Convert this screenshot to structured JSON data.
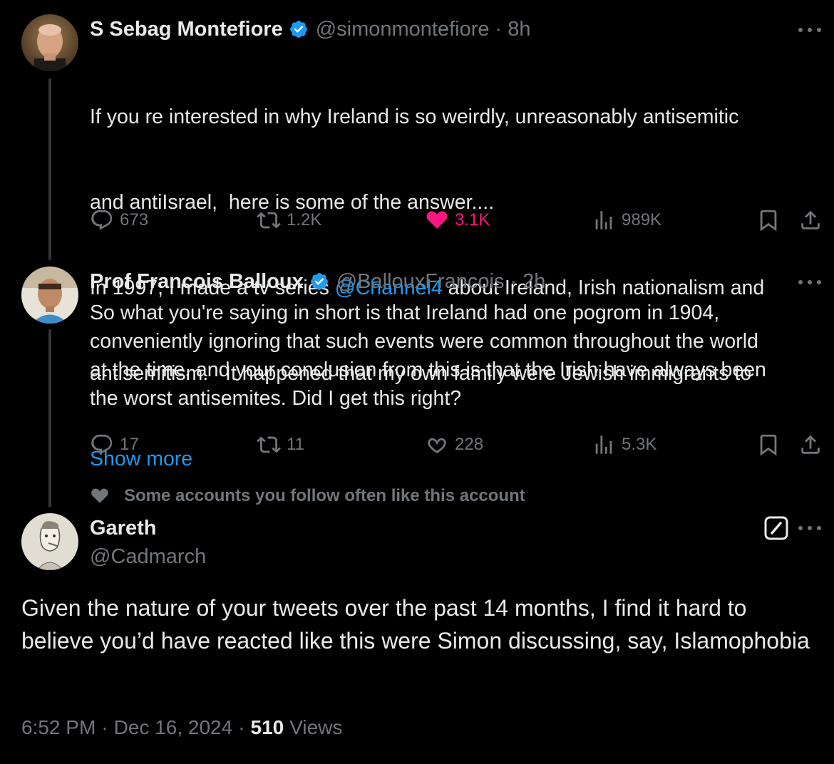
{
  "tweet1": {
    "name": "S Sebag Montefiore",
    "handle": "@simonmontefiore",
    "time": "8h",
    "text_lines": [
      "If you re interested in why Ireland is so weirdly, unreasonably antisemitic",
      "and antiIsrael,  here is some of the answer....",
      "In 1997, I made a tv series ",
      " about Ireland, Irish nationalism and",
      "antisemitism.   It happened that my own family were Jewish immigrants to"
    ],
    "mention": "@Channel4",
    "show_more": "Show more",
    "replies": "673",
    "reposts": "1.2K",
    "likes": "3.1K",
    "views": "989K"
  },
  "tweet2": {
    "name": "Prof Francois Balloux",
    "handle": "@BallouxFrancois",
    "time": "2h",
    "text": "So what you're saying in short is that Ireland had one pogrom in 1904,\nconveniently ignoring that such events were common throughout the world\nat the time, and your conclusion from this is that the Irish have always been\nthe worst antisemites. Did I get this right?",
    "replies": "17",
    "reposts": "11",
    "likes": "228",
    "views": "5.3K"
  },
  "social_context": "Some accounts you follow often like this account",
  "main": {
    "name": "Gareth",
    "handle": "@Cadmarch",
    "text": "Given the nature of your tweets over the past 14 months, I find it hard to believe you’d have reacted like this were Simon discussing, say, Islamophobia",
    "time": "6:52 PM",
    "date": "Dec 16, 2024",
    "views_count": "510",
    "views_label": "Views"
  },
  "separator": "·",
  "colors": {
    "background": "#000000",
    "text": "#e7e9ea",
    "muted": "#71767b",
    "link": "#1d9bf0",
    "like": "#f91880",
    "verified": "#1d9bf0"
  }
}
